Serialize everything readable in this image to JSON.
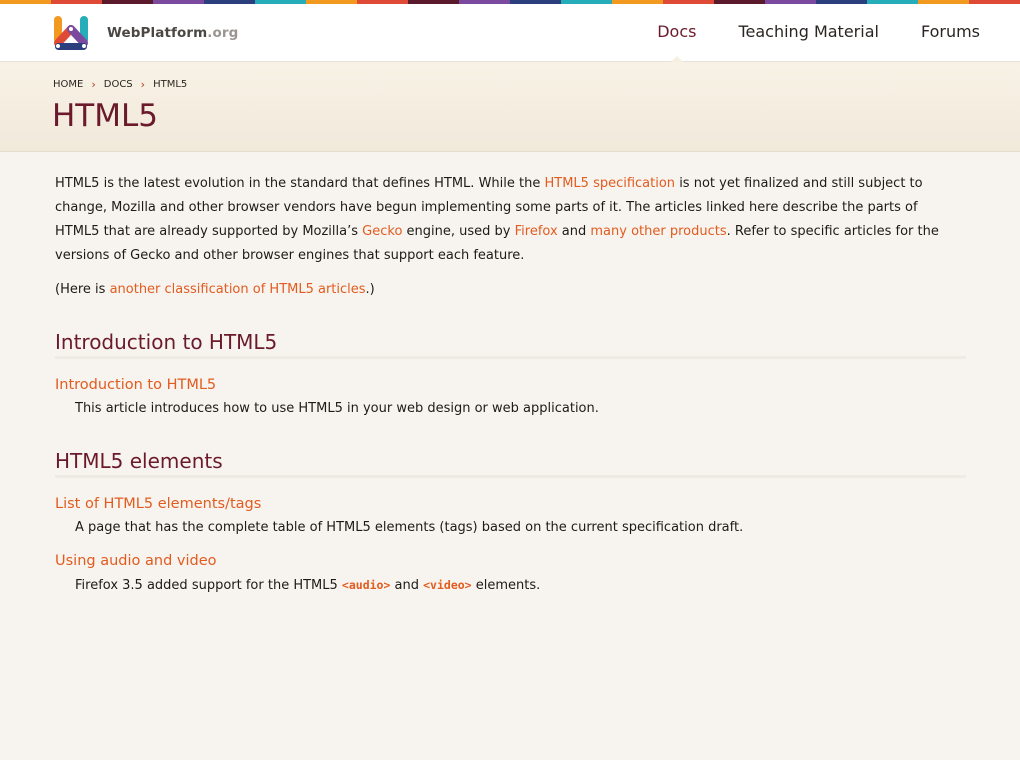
{
  "stripe_colors": [
    "#f29a1f",
    "#de4a35",
    "#5a1a2b",
    "#7b4a9e",
    "#2b3e7e",
    "#25adb9",
    "#f29a1f",
    "#de4a35",
    "#5a1a2b",
    "#7b4a9e",
    "#2b3e7e",
    "#25adb9",
    "#f29a1f",
    "#de4a35",
    "#5a1a2b",
    "#7b4a9e",
    "#2b3e7e",
    "#25adb9",
    "#f29a1f",
    "#de4a35"
  ],
  "header": {
    "logo_icon": "webplatform-logo",
    "wordmark": "WebPlatform",
    "wordmark_tld": ".org",
    "nav": [
      {
        "label": "Docs",
        "active": true
      },
      {
        "label": "Teaching Material",
        "active": false
      },
      {
        "label": "Forums",
        "active": false
      }
    ]
  },
  "breadcrumb": [
    "HOME",
    "DOCS",
    "HTML5"
  ],
  "page_title": "HTML5",
  "intro": {
    "p1_a": "HTML5 is the latest evolution in the standard that defines HTML. While the ",
    "link_spec": "HTML5 specification",
    "p1_b": " is not yet finalized and still subject to change, Mozilla and other browser vendors have begun implementing some parts of it. The articles linked here describe the parts of HTML5 that are already supported by Mozilla’s ",
    "link_gecko": "Gecko",
    "p1_c": " engine, used by ",
    "link_firefox": "Firefox",
    "p1_d": " and ",
    "link_products": "many other products",
    "p1_e": ". Refer to specific articles for the versions of Gecko and other browser engines that support each feature.",
    "p2_a": "(Here is ",
    "link_classification": "another classification of HTML5 articles",
    "p2_b": ".)"
  },
  "sections": [
    {
      "heading": "Introduction to HTML5",
      "entries": [
        {
          "term": "Introduction to HTML5",
          "def": "This article introduces how to use HTML5 in your web design or web application."
        }
      ]
    },
    {
      "heading": "HTML5 elements",
      "entries": [
        {
          "term": "List of HTML5 elements/tags",
          "def": "A page that has the complete table of HTML5 elements (tags) based on the current specification draft."
        },
        {
          "term": "Using audio and video",
          "def_a": "Firefox 3.5 added support for the HTML5 ",
          "code1": "<audio>",
          "def_b": " and ",
          "code2": "<video>",
          "def_c": " elements."
        }
      ]
    }
  ],
  "colors": {
    "accent": "#e25b1f",
    "brand": "#6b1a2c"
  }
}
